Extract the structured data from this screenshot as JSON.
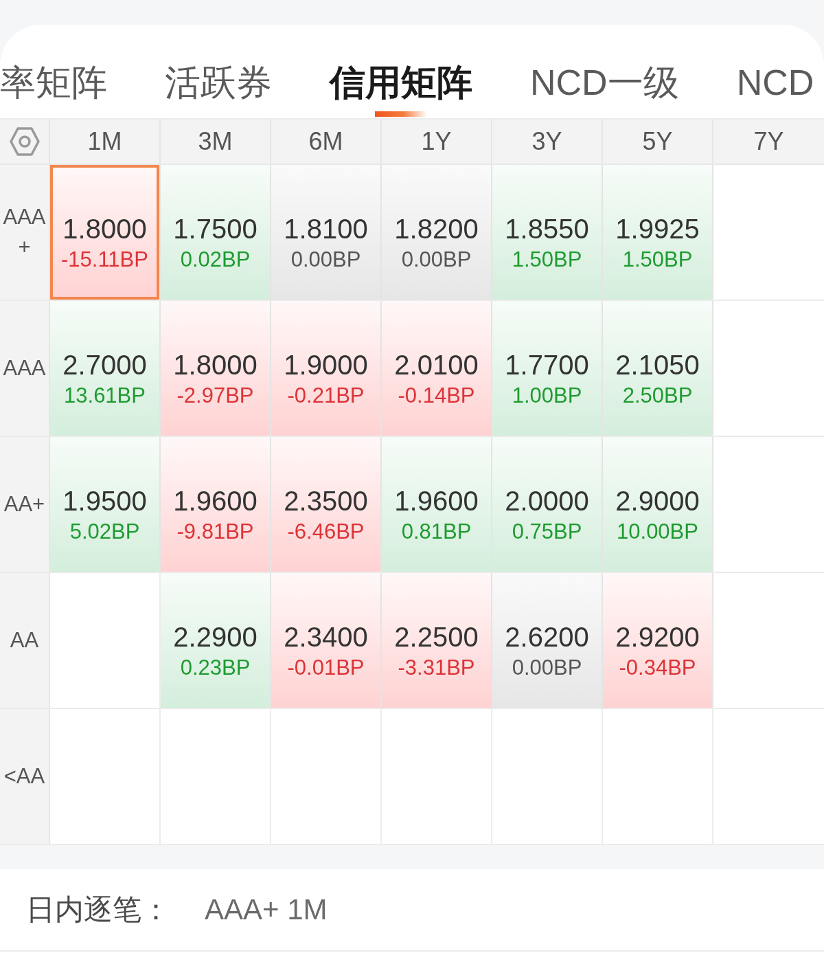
{
  "tabs": [
    {
      "label": "率矩阵",
      "selected": false
    },
    {
      "label": "活跃券",
      "selected": false
    },
    {
      "label": "信用矩阵",
      "selected": true
    },
    {
      "label": "NCD一级",
      "selected": false
    },
    {
      "label": "NCD",
      "selected": false
    }
  ],
  "matrix": {
    "columns": [
      "1M",
      "3M",
      "6M",
      "1Y",
      "3Y",
      "5Y",
      "7Y"
    ],
    "rows": [
      {
        "label": "AAA+",
        "cells": [
          {
            "rate": "1.8000",
            "change": "-15.11BP",
            "kind": "down",
            "selected": true
          },
          {
            "rate": "1.7500",
            "change": "0.02BP",
            "kind": "up",
            "selected": false
          },
          {
            "rate": "1.8100",
            "change": "0.00BP",
            "kind": "flat",
            "selected": false
          },
          {
            "rate": "1.8200",
            "change": "0.00BP",
            "kind": "flat",
            "selected": false
          },
          {
            "rate": "1.8550",
            "change": "1.50BP",
            "kind": "up",
            "selected": false
          },
          {
            "rate": "1.9925",
            "change": "1.50BP",
            "kind": "up",
            "selected": false
          },
          null
        ]
      },
      {
        "label": "AAA",
        "cells": [
          {
            "rate": "2.7000",
            "change": "13.61BP",
            "kind": "up",
            "selected": false
          },
          {
            "rate": "1.8000",
            "change": "-2.97BP",
            "kind": "down",
            "selected": false
          },
          {
            "rate": "1.9000",
            "change": "-0.21BP",
            "kind": "down",
            "selected": false
          },
          {
            "rate": "2.0100",
            "change": "-0.14BP",
            "kind": "down",
            "selected": false
          },
          {
            "rate": "1.7700",
            "change": "1.00BP",
            "kind": "up",
            "selected": false
          },
          {
            "rate": "2.1050",
            "change": "2.50BP",
            "kind": "up",
            "selected": false
          },
          null
        ]
      },
      {
        "label": "AA+",
        "cells": [
          {
            "rate": "1.9500",
            "change": "5.02BP",
            "kind": "up",
            "selected": false
          },
          {
            "rate": "1.9600",
            "change": "-9.81BP",
            "kind": "down",
            "selected": false
          },
          {
            "rate": "2.3500",
            "change": "-6.46BP",
            "kind": "down",
            "selected": false
          },
          {
            "rate": "1.9600",
            "change": "0.81BP",
            "kind": "up",
            "selected": false
          },
          {
            "rate": "2.0000",
            "change": "0.75BP",
            "kind": "up",
            "selected": false
          },
          {
            "rate": "2.9000",
            "change": "10.00BP",
            "kind": "up",
            "selected": false
          },
          null
        ]
      },
      {
        "label": "AA",
        "cells": [
          null,
          {
            "rate": "2.2900",
            "change": "0.23BP",
            "kind": "up",
            "selected": false
          },
          {
            "rate": "2.3400",
            "change": "-0.01BP",
            "kind": "down",
            "selected": false
          },
          {
            "rate": "2.2500",
            "change": "-3.31BP",
            "kind": "down",
            "selected": false
          },
          {
            "rate": "2.6200",
            "change": "0.00BP",
            "kind": "flat",
            "selected": false
          },
          {
            "rate": "2.9200",
            "change": "-0.34BP",
            "kind": "down",
            "selected": false
          },
          null
        ]
      },
      {
        "label": "<AA",
        "cells": [
          null,
          null,
          null,
          null,
          null,
          null,
          null
        ]
      }
    ]
  },
  "footer": {
    "label": "日内逐笔：",
    "value": "AAA+ 1M"
  }
}
